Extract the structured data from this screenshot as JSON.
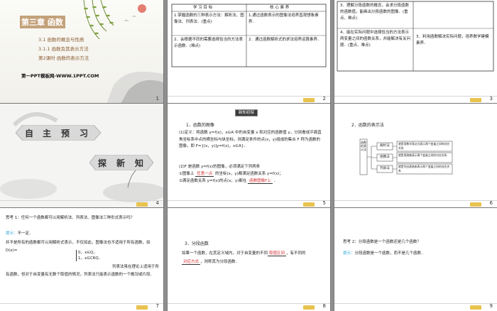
{
  "slides": [
    {
      "number": "1",
      "title": "第三章  函数",
      "section": "3.1    函数的概念与性质",
      "subsection": "3.1.1    函数及其表示方法",
      "lesson": "第2课时    函数的表示方法",
      "brand": "第一PPT模板网-WWW.1PPT.COM"
    },
    {
      "number": "2",
      "col1_header": "学  习  目  标",
      "col2_header": "核  心  素  养",
      "row1_col1": "1.掌握函数的三种表示方法：解析法、图像法、列表法．(重点)",
      "row1_col2": "1.通过函数表示的图像法培养直观想象素养．",
      "row2_col1": "2．会根据不同的需要选择恰当的方法表示函数．(难点)",
      "row2_col2": "2．通过函数解析式的求法培养运算素养．"
    },
    {
      "number": "3",
      "row1_col1": "3．理解分段函数的概念，会求分段函数的函数值，能画出分段函数的图像．(重点、难点)",
      "row2_col1": "4．能在实际问题中选择恰当的方法表示两变量之间的函数关系，并能解决有关问题．(重点、难点)",
      "row2_col2": "3．利用函数解决实际问题，培养数学建模素养．"
    },
    {
      "number": "4",
      "left_chars": [
        "自",
        "主",
        "预",
        "习"
      ],
      "right_chars": [
        "探",
        "新",
        "知"
      ]
    },
    {
      "number": "5",
      "tag": "新知初探",
      "heading": "1．函数的图像",
      "p1": "(1)定义：将函数 y=f(x)，x∈A 中的自变量 x 和对应的函数值 y，分别看成平面直角坐标系中点的横坐标与纵坐标，则满足条件的点(x，y)组成的集合 F 称为函数的图像，即 F={(x，y)|y=f(x)，x∈A}．",
      "p2": "(2)F 是函数 y=f(x)的图像，必须满足下列两条",
      "p3_pre": "①图像上",
      "p3_red": "任意一点",
      "p3_post": "的坐标(x，y)都满足函数关系 y=f(x)；",
      "p4_pre": "②满足函数关系 y=f(x)的点(x，y)都在",
      "p4_red": "函数图像F上",
      "p4_post": "．"
    },
    {
      "number": "6",
      "heading": "2．函数的表示法",
      "root": "函数的表示法",
      "b1": "解析法",
      "b2": "图像法",
      "b3": "列表法",
      "d1": "就是用数学表达式表示两个变量之间的对应关系",
      "d2": "就是用图像表示两个变量之间的对应关系",
      "d3": "就是列出表格来表示两个变量之间的对应关系"
    },
    {
      "number": "7",
      "q1": "思考 1：任何一个函数都可以用解析法、列表法、图像法三种形式表示吗？",
      "hint": "提示：",
      "a1": "不一定．",
      "a2": "并不是所有的函数都可以用解析式表示，不仅如此，图像法也不适用于所有函数，如 D(x)=",
      "case1": "0，x∈Q，",
      "case2": "1，x∈∁RQ．",
      "a3": "列表法虽在理论上适用于所有函数，但对于自变量有无数个取值的情况，列表法只能表示函数的一个概况或片段．"
    },
    {
      "number": "8",
      "heading": "3．分段函数",
      "p1_pre": "如果一个函数，在其定义域内，对于自变量的不同",
      "p1_red": "取值区间",
      "p1_post": "，有不同的",
      "p2_red": "对应方式",
      "p2_post": "，则称其为分段函数．"
    },
    {
      "number": "9",
      "q2": "思考 2：分段函数是一个函数还是几个函数？",
      "hint": "提示：",
      "a": "分段函数是一个函数，而不是几个函数．"
    }
  ]
}
